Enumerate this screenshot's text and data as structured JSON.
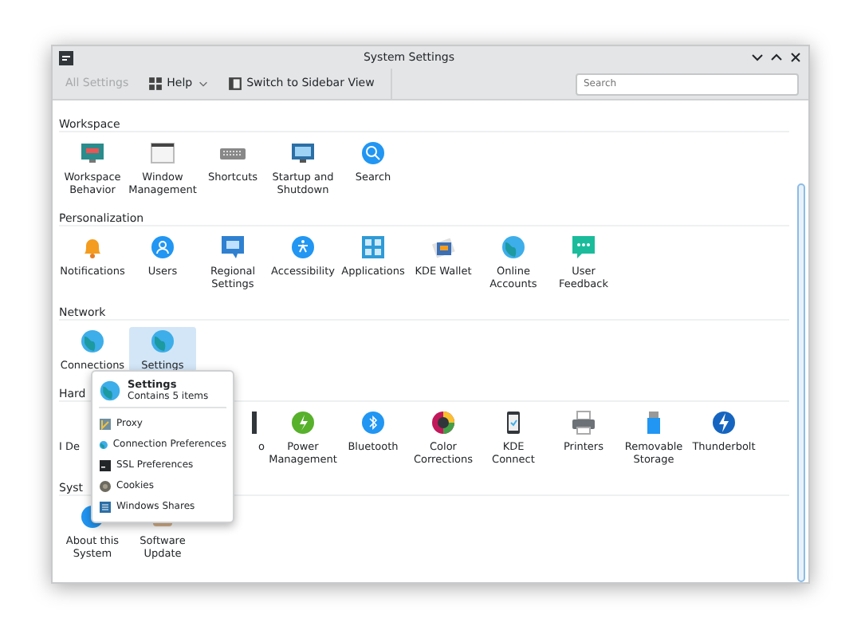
{
  "window": {
    "title": "System Settings"
  },
  "toolbar": {
    "items": [
      {
        "label": "All Settings",
        "disabled": true,
        "kind": "text"
      },
      {
        "label": "Help",
        "disabled": false,
        "kind": "menu"
      },
      {
        "label": "Switch to Sidebar View",
        "disabled": false,
        "kind": "sidebar"
      }
    ]
  },
  "search": {
    "placeholder": "Search"
  },
  "sections": [
    {
      "title": "Workspace",
      "items": [
        {
          "label": "Workspace Behavior"
        },
        {
          "label": "Window Management"
        },
        {
          "label": "Shortcuts"
        },
        {
          "label": "Startup and Shutdown"
        },
        {
          "label": "Search"
        }
      ]
    },
    {
      "title": "Personalization",
      "items": [
        {
          "label": "Notifications"
        },
        {
          "label": "Users"
        },
        {
          "label": "Regional Settings"
        },
        {
          "label": "Accessibility"
        },
        {
          "label": "Applications"
        },
        {
          "label": "KDE Wallet"
        },
        {
          "label": "Online Accounts"
        },
        {
          "label": "User Feedback"
        }
      ]
    },
    {
      "title": "Network",
      "items": [
        {
          "label": "Connections",
          "selected": false
        },
        {
          "label": "Settings",
          "selected": true
        }
      ]
    },
    {
      "title": "Hard",
      "items": [
        {
          "label": "I De",
          "kind": "cut_left"
        },
        {
          "kind": "hidden"
        },
        {
          "label": "o",
          "kind": "cut_right"
        },
        {
          "label": "Power Management",
          "kind": "full"
        },
        {
          "label": "Bluetooth",
          "kind": "full"
        },
        {
          "label": "Color Corrections",
          "kind": "full"
        },
        {
          "label": "KDE Connect",
          "kind": "full"
        },
        {
          "label": "Printers",
          "kind": "full"
        },
        {
          "label": "Removable Storage",
          "kind": "full"
        },
        {
          "label": "Thunderbolt",
          "kind": "full"
        }
      ]
    },
    {
      "title": "Syst",
      "items": [
        {
          "label": "About this System"
        },
        {
          "label": "Software Update"
        }
      ]
    }
  ],
  "popup": {
    "title": "Settings",
    "subtitle": "Contains 5 items",
    "items": [
      {
        "label": "Proxy"
      },
      {
        "label": "Connection Preferences"
      },
      {
        "label": "SSL Preferences"
      },
      {
        "label": "Cookies"
      },
      {
        "label": "Windows Shares"
      }
    ]
  }
}
